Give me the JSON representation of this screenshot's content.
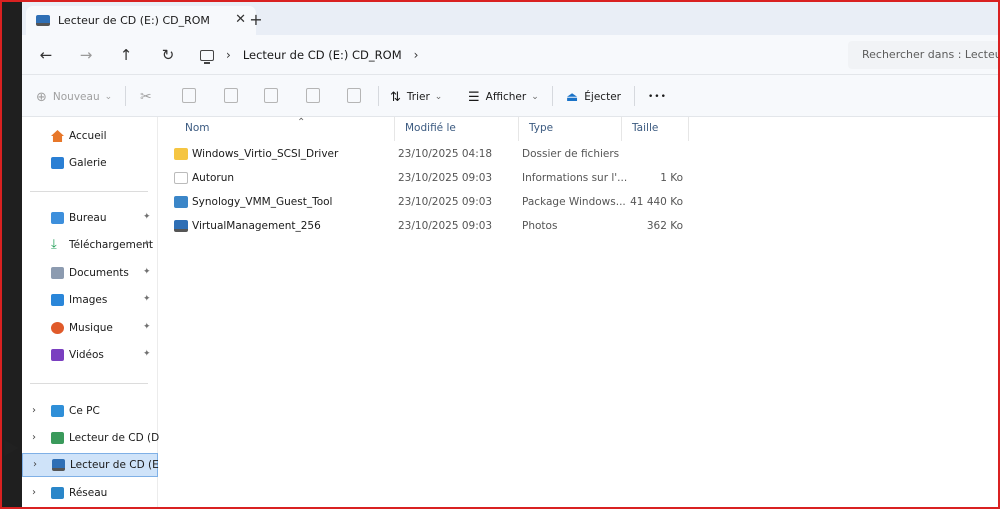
{
  "tab": {
    "title": "Lecteur de CD (E:) CD_ROM",
    "close_glyph": "✕",
    "new_tab_glyph": "+"
  },
  "nav": {
    "back_glyph": "←",
    "forward_glyph": "→",
    "up_glyph": "↑",
    "refresh_glyph": "↻",
    "breadcrumb_sep": "›",
    "breadcrumb_item": "Lecteur de CD (E:) CD_ROM",
    "breadcrumb_trailing": "›",
    "search_placeholder": "Rechercher dans : Lecteur"
  },
  "commands": {
    "new": "Nouveau",
    "new_chevron": "⌄",
    "sort": "Trier",
    "sort_chevron": "⌄",
    "view": "Afficher",
    "view_chevron": "⌄",
    "eject": "Éjecter",
    "more": "•••"
  },
  "sidebar": {
    "home": "Accueil",
    "gallery": "Galerie",
    "desktop": "Bureau",
    "downloads": "Téléchargement",
    "documents": "Documents",
    "images": "Images",
    "music": "Musique",
    "videos": "Vidéos",
    "this_pc": "Ce PC",
    "cd_d": "Lecteur de CD (D:) C",
    "cd_e": "Lecteur de CD (E:) C",
    "network": "Réseau",
    "pin_glyph": "📌",
    "chevron_glyph": "›"
  },
  "columns": {
    "name": "Nom",
    "modified": "Modifié le",
    "type": "Type",
    "size": "Taille",
    "sort_glyph": "⌃"
  },
  "files": [
    {
      "name": "Windows_Virtio_SCSI_Driver",
      "modified": "23/10/2025 04:18",
      "type": "Dossier de fichiers",
      "size": "",
      "icon": "folder-icon"
    },
    {
      "name": "Autorun",
      "modified": "23/10/2025 09:03",
      "type": "Informations sur l'...",
      "size": "1 Ko",
      "icon": "settings-file-icon"
    },
    {
      "name": "Synology_VMM_Guest_Tool",
      "modified": "23/10/2025 09:03",
      "type": "Package Windows...",
      "size": "41 440 Ko",
      "icon": "installer-icon"
    },
    {
      "name": "VirtualManagement_256",
      "modified": "23/10/2025 09:03",
      "type": "Photos",
      "size": "362 Ko",
      "icon": "image-file-icon"
    }
  ],
  "colors": {
    "frame_border": "#d92121",
    "selection_bg": "#cfe3f9",
    "selection_border": "#7fb0e6",
    "folder": "#f5c542",
    "accent": "#1a73c8"
  }
}
